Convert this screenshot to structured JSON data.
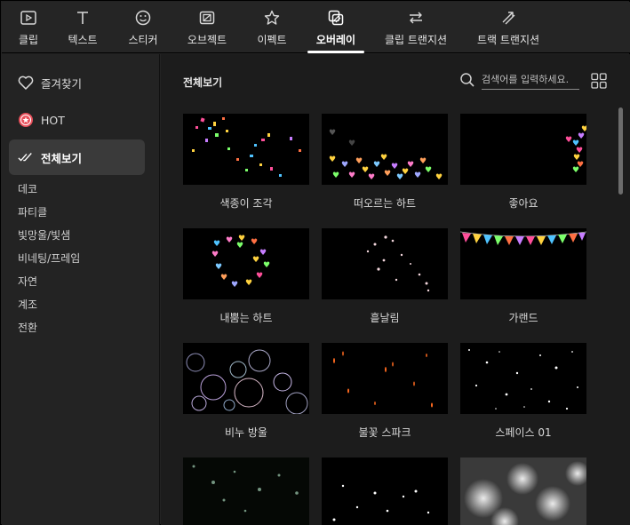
{
  "tabs": [
    {
      "label": "클립",
      "icon": "play-icon"
    },
    {
      "label": "텍스트",
      "icon": "text-icon"
    },
    {
      "label": "스티커",
      "icon": "sticker-icon"
    },
    {
      "label": "오브젝트",
      "icon": "object-icon"
    },
    {
      "label": "이펙트",
      "icon": "effect-star-icon"
    },
    {
      "label": "오버레이",
      "icon": "overlay-icon",
      "active": true
    },
    {
      "label": "클립 트랜지션",
      "icon": "clip-transition-icon"
    },
    {
      "label": "트랙 트랜지션",
      "icon": "track-transition-icon"
    }
  ],
  "sidebar": {
    "main": [
      {
        "label": "즐겨찾기",
        "icon": "heart-icon"
      },
      {
        "label": "HOT",
        "icon": "hot-badge-icon"
      },
      {
        "label": "전체보기",
        "icon": "all-check-icon",
        "active": true
      }
    ],
    "categories": [
      "데코",
      "파티클",
      "빛망울/빛샘",
      "비네팅/프레임",
      "자연",
      "계조",
      "전환"
    ]
  },
  "content": {
    "title": "전체보기",
    "search_placeholder": "검색어를 입력하세요.",
    "items": [
      {
        "label": "색종이 조각"
      },
      {
        "label": "떠오르는 하트"
      },
      {
        "label": "좋아요"
      },
      {
        "label": "내뿜는 하트"
      },
      {
        "label": "흩날림"
      },
      {
        "label": "가랜드"
      },
      {
        "label": "비누 방울"
      },
      {
        "label": "불꽃 스파크"
      },
      {
        "label": "스페이스 01"
      },
      {
        "label": ""
      },
      {
        "label": ""
      },
      {
        "label": ""
      }
    ]
  },
  "colors": {
    "accent_active": "#ffffff",
    "hot_badge": "#e8505b",
    "background": "#1c1c1c",
    "sidebar": "#232323"
  }
}
